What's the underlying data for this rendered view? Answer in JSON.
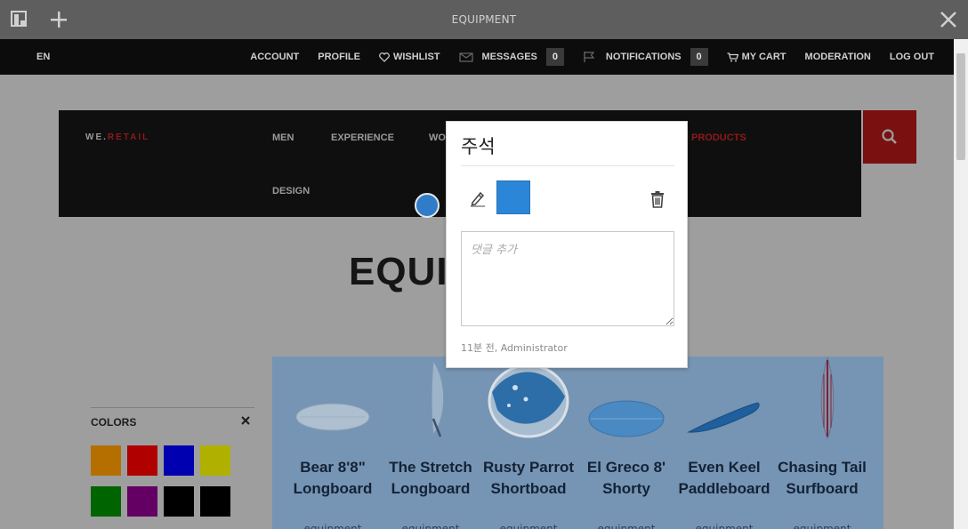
{
  "editor": {
    "title": "EQUIPMENT",
    "icons": [
      "pages-panel-icon",
      "add-icon",
      "close-icon"
    ]
  },
  "site_top": {
    "lang": "EN",
    "account": "ACCOUNT",
    "profile": "PROFILE",
    "wishlist": "WISHLIST",
    "messages": "MESSAGES",
    "messages_count": "0",
    "notifications": "NOTIFICATIONS",
    "notifications_count": "0",
    "cart": "MY CART",
    "moderation": "MODERATION",
    "logout": "LOG OUT"
  },
  "nav": {
    "logo_prefix": "WE.",
    "logo_suffix": "RETAIL",
    "items": [
      "MEN",
      "EXPERIENCE",
      "WO",
      "PRODUCTS",
      "DESIGN"
    ]
  },
  "hero": {
    "title": "EQUI"
  },
  "colors_panel": {
    "title": "COLORS",
    "swatches": [
      "#b56f00",
      "#b00000",
      "#0000b0",
      "#b0b000",
      "#006400",
      "#640064",
      "#000000",
      "#000000"
    ]
  },
  "products": [
    {
      "name": "Bear 8'8\" Longboard",
      "category": "equipment"
    },
    {
      "name": "The Stretch Longboard",
      "category": "equipment"
    },
    {
      "name": "Rusty Parrot Shortboad",
      "category": "equipment"
    },
    {
      "name": "El Greco 8' Shorty",
      "category": "equipment"
    },
    {
      "name": "Even Keel Paddleboard",
      "category": "equipment"
    },
    {
      "name": "Chasing Tail Surfboard",
      "category": "equipment"
    }
  ],
  "annotation": {
    "title": "주석",
    "color": "#2b86d8",
    "comment_placeholder": "댓글 추가",
    "meta": "11분 전, Administrator"
  },
  "accent_colors": {
    "editor_bar": "#5e5e5e",
    "brand_red": "#8e1a1a",
    "pin_blue": "#2f7dc9"
  }
}
